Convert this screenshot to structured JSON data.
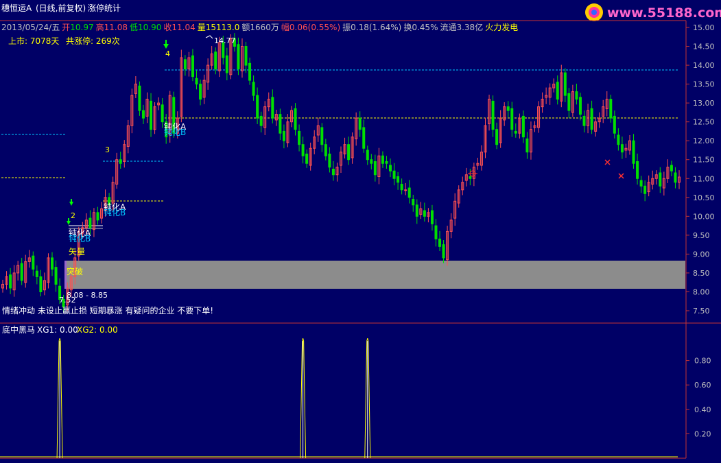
{
  "header": {
    "title": "穗恒运A",
    "mode": "(日线,前复权)",
    "formula": "涨停统计"
  },
  "info_bar": [
    {
      "text": "2013/05/24/五",
      "color": "#c0c0c0"
    },
    {
      "text": "开",
      "color": "#ff5050"
    },
    {
      "text": "10.97",
      "color": "#00e000"
    },
    {
      "text": "高",
      "color": "#ff5050"
    },
    {
      "text": "11.08",
      "color": "#ff5050"
    },
    {
      "text": "低",
      "color": "#00e000"
    },
    {
      "text": "10.90",
      "color": "#00e000"
    },
    {
      "text": "收",
      "color": "#ff5050"
    },
    {
      "text": "11.04",
      "color": "#ff5050"
    },
    {
      "text": "量",
      "color": "#ffff00"
    },
    {
      "text": "15113.0",
      "color": "#ffff00"
    },
    {
      "text": "额1660万",
      "color": "#c0c0c0"
    },
    {
      "text": "幅",
      "color": "#ff5050"
    },
    {
      "text": "0.06(0.55%)",
      "color": "#ff5050"
    },
    {
      "text": "振0.18(1.64%)",
      "color": "#c0c0c0"
    },
    {
      "text": "换0.45%",
      "color": "#c0c0c0"
    },
    {
      "text": "流通3.38亿",
      "color": "#c0c0c0"
    },
    {
      "text": "火力发电",
      "color": "#ffff00"
    }
  ],
  "stats": {
    "listed": "上市: 7078天",
    "limit_up": "共涨停: 269次"
  },
  "labels": {
    "high_mark": "14.77",
    "low_mark": "7.52",
    "range_text": "8.08 - 8.85",
    "volume_label": "矢量",
    "breakout_label": "突破",
    "bottom_message": "情绪冲动  未设止赢止损  短期暴涨  有疑问的企业  不要下单!",
    "num_2": "2",
    "num_3": "3",
    "num_4": "4",
    "blunt_1a": "钝化A",
    "blunt_1b": "钝化B",
    "blunt_2a": "钝化A",
    "blunt_2b": "钝化B",
    "blunt_3a": "钝化A",
    "blunt_3b": "钝化B"
  },
  "watermark": "www.55188.com",
  "indicator": {
    "name": "底中黑马",
    "xg1": "XG1: 0.00",
    "xg2": "XG2: 0.00"
  },
  "colors": {
    "background": "#000066",
    "up_candle": "#ff5050",
    "down_candle": "#00e000",
    "axis": "#c83232",
    "price_text": "#c0c0c0",
    "highlight_band": "#8c8c8c",
    "cyan_line": "#00c8ff",
    "yellow_line": "#ffff00"
  },
  "chart_data": [
    {
      "type": "candlestick",
      "title": "穗恒运A (日线,前复权)",
      "y_axis_ticks": [
        "15.00",
        "14.50",
        "14.00",
        "13.50",
        "13.00",
        "12.50",
        "12.00",
        "11.50",
        "11.00",
        "10.50",
        "10.00",
        "9.50",
        "9.00",
        "8.50",
        "8.00",
        "7.50"
      ],
      "ylim": [
        7.3,
        15.1
      ],
      "closes": [
        8.2,
        8.4,
        8.1,
        8.5,
        8.7,
        8.3,
        8.8,
        8.9,
        8.6,
        8.4,
        8.0,
        8.3,
        8.9,
        8.6,
        8.2,
        7.8,
        7.6,
        8.1,
        8.4,
        8.9,
        9.6,
        9.7,
        9.9,
        9.7,
        10.1,
        9.9,
        10.2,
        10.5,
        10.3,
        10.9,
        11.5,
        11.4,
        11.9,
        12.4,
        13.2,
        13.5,
        12.8,
        12.6,
        13.1,
        12.3,
        12.9,
        13.0,
        12.5,
        12.1,
        13.2,
        12.2,
        12.6,
        14.2,
        13.9,
        14.2,
        13.7,
        13.5,
        13.1,
        13.6,
        14.0,
        14.3,
        13.9,
        14.6,
        14.2,
        13.8,
        14.7,
        14.5,
        13.9,
        14.5,
        14.0,
        13.6,
        13.2,
        12.6,
        12.4,
        12.9,
        13.1,
        12.6,
        12.7,
        12.2,
        12.0,
        12.5,
        12.8,
        12.3,
        11.9,
        11.6,
        11.4,
        11.8,
        12.1,
        12.4,
        11.9,
        11.6,
        11.3,
        11.1,
        11.3,
        11.7,
        11.9,
        11.5,
        12.1,
        12.6,
        12.3,
        11.8,
        11.5,
        11.4,
        11.1,
        11.6,
        11.4,
        11.4,
        11.2,
        11.0,
        10.9,
        10.7,
        10.7,
        10.5,
        10.3,
        10.0,
        10.2,
        10.0,
        10.1,
        9.8,
        9.4,
        9.2,
        8.9,
        9.6,
        9.9,
        10.4,
        10.7,
        10.9,
        11.1,
        11.0,
        11.3,
        11.4,
        11.7,
        12.4,
        13.1,
        12.3,
        11.9,
        12.6,
        12.9,
        12.8,
        12.3,
        12.2,
        12.6,
        12.1,
        11.7,
        12.3,
        12.4,
        12.9,
        13.1,
        13.2,
        13.4,
        13.5,
        13.1,
        13.8,
        13.2,
        12.8,
        13.3,
        13.1,
        12.7,
        12.4,
        12.8,
        12.3,
        12.5,
        12.6,
        12.9,
        13.1,
        12.6,
        12.2,
        11.9,
        11.7,
        11.8,
        12.0,
        11.4,
        11.0,
        10.8,
        10.6,
        10.9,
        11.0,
        11.1,
        10.8,
        11.0,
        11.3,
        11.2,
        10.9,
        11.04
      ]
    },
    {
      "type": "line",
      "title": "底中黑马",
      "y_axis_ticks": [
        "0.80",
        "0.60",
        "0.40",
        "0.20"
      ],
      "ylim": [
        0,
        1
      ],
      "series": [
        {
          "name": "XG1",
          "values": [
            0
          ]
        },
        {
          "name": "XG2",
          "values": [
            0
          ]
        }
      ],
      "spike_bar_indices": [
        15,
        79,
        96
      ]
    }
  ]
}
